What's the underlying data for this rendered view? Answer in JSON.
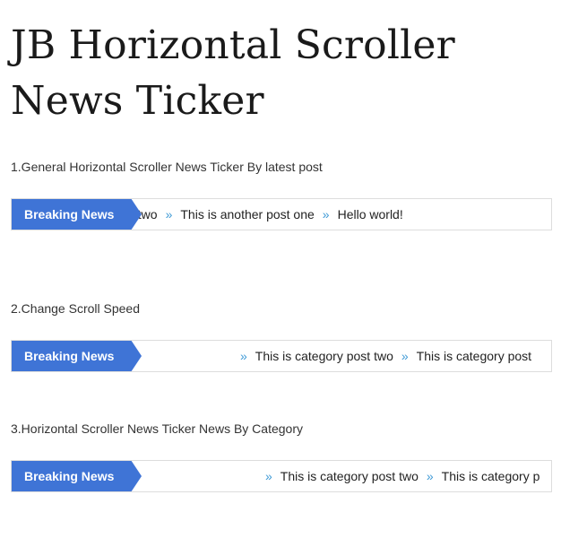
{
  "page_title": "JB Horizontal Scroller News Ticker",
  "sections": [
    {
      "heading": "1.General Horizontal Scroller News Ticker By latest post",
      "label": "Breaking News",
      "items": [
        "st two",
        "This is another post one",
        "Hello world!"
      ]
    },
    {
      "heading": "2.Change Scroll Speed",
      "label": "Breaking News",
      "items": [
        "This is category post two",
        "This is category post"
      ]
    },
    {
      "heading": "3.Horizontal Scroller News Ticker News By Category",
      "label": "Breaking News",
      "items": [
        "This is category post two",
        "This is category p"
      ]
    }
  ],
  "separator_icon": "double-chevron-right-icon",
  "colors": {
    "label_bg": "#3f74d6",
    "separator": "#3f9ad6",
    "border": "#dddddd"
  }
}
